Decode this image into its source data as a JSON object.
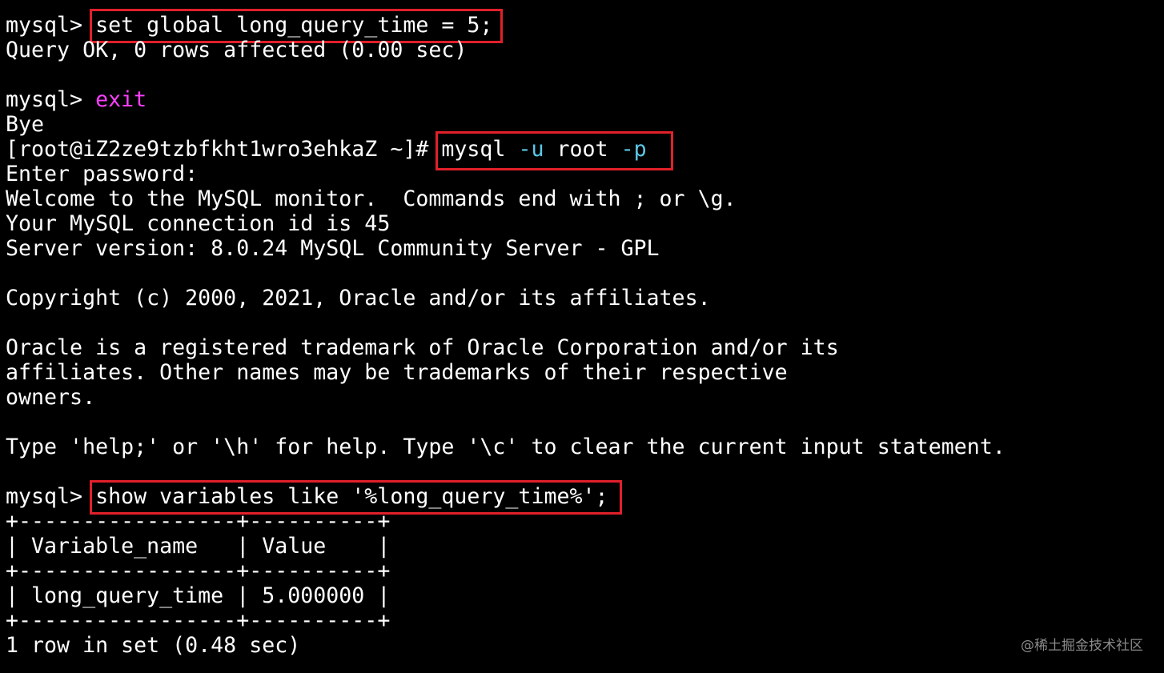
{
  "terminal": {
    "prompt": "mysql> ",
    "cmd_set": "set global long_query_time = 5;",
    "set_result": "Query OK, 0 rows affected (0.00 sec)",
    "cmd_exit": "exit",
    "bye": "Bye",
    "shell_prompt": "[root@iZ2ze9tzbfkht1wro3ehkaZ ~]# ",
    "login_cmd": {
      "part1": "mysql ",
      "flag_u": "-u",
      "part2": " root ",
      "flag_p": "-p"
    },
    "enter_password": "Enter password:",
    "welcome": "Welcome to the MySQL monitor.  Commands end with ; or \\g.",
    "connection_id": "Your MySQL connection id is 45",
    "server_version": "Server version: 8.0.24 MySQL Community Server - GPL",
    "copyright": "Copyright (c) 2000, 2021, Oracle and/or its affiliates.",
    "trademark_1": "Oracle is a registered trademark of Oracle Corporation and/or its",
    "trademark_2": "affiliates. Other names may be trademarks of their respective",
    "trademark_3": "owners.",
    "help_hint": "Type 'help;' or '\\h' for help. Type '\\c' to clear the current input statement.",
    "cmd_show": "show variables like '%long_query_time%';",
    "table": {
      "border": "+-----------------+----------+",
      "header": "| Variable_name   | Value    |",
      "row": "| long_query_time | 5.000000 |"
    },
    "result_summary": "1 row in set (0.48 sec)"
  },
  "colors": {
    "background": "#000000",
    "text": "#ffffff",
    "highlight_box": "#e0202a",
    "exit_cmd": "#ff40ff",
    "flags": "#5cc8e8"
  },
  "watermark": "@稀土掘金技术社区"
}
